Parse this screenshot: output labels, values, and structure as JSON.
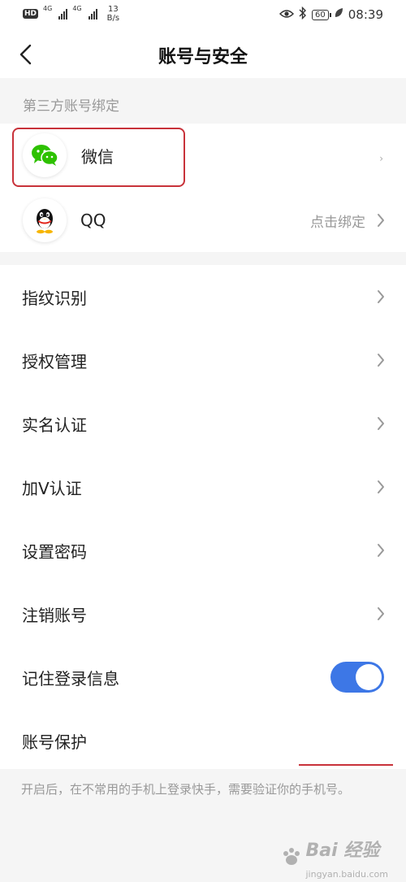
{
  "status_bar": {
    "hd_badge": "HD",
    "sim1_label": "4G",
    "sim2_label": "4G",
    "net_speed_value": "13",
    "net_speed_unit": "B/s",
    "battery": "60",
    "time": "08:39"
  },
  "nav": {
    "title": "账号与安全"
  },
  "third_party": {
    "header": "第三方账号绑定",
    "items": [
      {
        "label": "微信",
        "icon": "wechat-icon",
        "action": ""
      },
      {
        "label": "QQ",
        "icon": "qq-icon",
        "action": "点击绑定"
      }
    ]
  },
  "settings": {
    "items": [
      {
        "label": "指纹识别"
      },
      {
        "label": "授权管理"
      },
      {
        "label": "实名认证"
      },
      {
        "label": "加V认证"
      },
      {
        "label": "设置密码"
      },
      {
        "label": "注销账号"
      },
      {
        "label": "记住登录信息",
        "toggle": true
      },
      {
        "label": "账号保护"
      }
    ]
  },
  "footer": {
    "hint": "开启后，在不常用的手机上登录快手，需要验证你的手机号。"
  },
  "watermark": {
    "brand": "Bai 经验",
    "sub": "jingyan.baidu.com"
  },
  "colors": {
    "accent_blue": "#3d77e6",
    "highlight_red": "#c8323a",
    "wechat_green": "#2dc100"
  }
}
